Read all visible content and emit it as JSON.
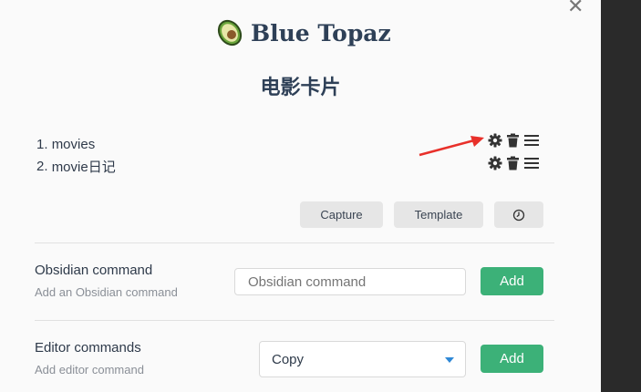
{
  "brand": {
    "name": "Blue Topaz",
    "logo_icon": "avocado-icon"
  },
  "page_title": "电影卡片",
  "choices": [
    {
      "number": "1.",
      "name": "movies"
    },
    {
      "number": "2.",
      "name": "movie日记"
    }
  ],
  "row_icons": [
    "gear-icon",
    "trash-icon",
    "menu-icon"
  ],
  "buttons": {
    "capture": "Capture",
    "template": "Template",
    "macro_icon": "clock-icon"
  },
  "obsidian_command": {
    "name": "Obsidian command",
    "description": "Add an Obsidian command",
    "placeholder": "Obsidian command",
    "add_label": "Add"
  },
  "editor_commands": {
    "name": "Editor commands",
    "description": "Add editor command",
    "selected": "Copy",
    "add_label": "Add"
  },
  "colors": {
    "accent_green": "#3cb178",
    "annotation_arrow": "#e8302a",
    "heading": "#2e4057"
  }
}
